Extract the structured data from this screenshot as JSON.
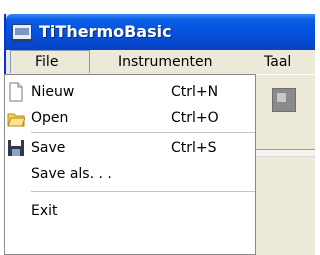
{
  "window": {
    "title": "TiThermoBasic",
    "icon": "app-monitor-icon"
  },
  "menubar": {
    "items": [
      "File",
      "Instrumenten",
      "Taal"
    ]
  },
  "file_menu": {
    "items": [
      {
        "label": "Nieuw",
        "shortcut": "Ctrl+N",
        "icon": "new-document-icon"
      },
      {
        "label": "Open",
        "shortcut": "Ctrl+O",
        "icon": "open-folder-icon"
      },
      {
        "label": "Save",
        "shortcut": "Ctrl+S",
        "icon": "save-disk-icon"
      },
      {
        "label": "Save als. . .",
        "shortcut": "",
        "icon": ""
      },
      {
        "label": "Exit",
        "shortcut": "",
        "icon": ""
      }
    ]
  },
  "colors": {
    "titlebar": "#0550dc",
    "menu_bg": "#ffffff",
    "chrome": "#ece9d8"
  }
}
